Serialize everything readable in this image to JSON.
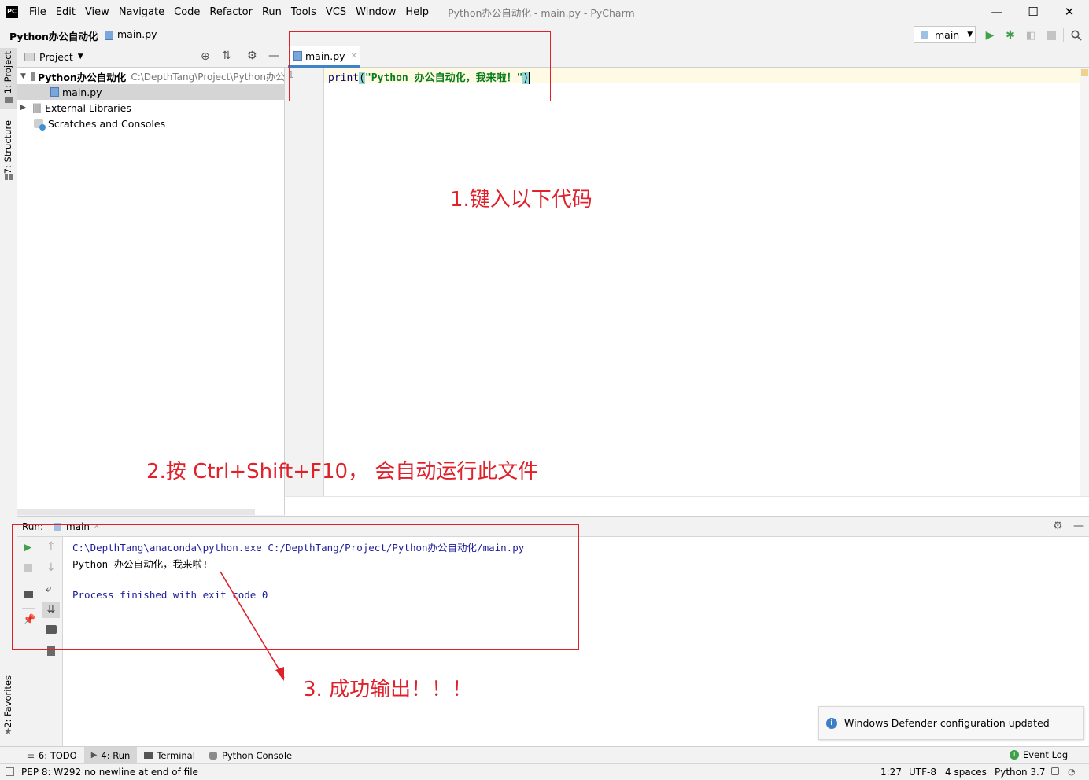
{
  "window": {
    "title": "Python办公自动化 - main.py - PyCharm"
  },
  "menu": [
    {
      "label": "File"
    },
    {
      "label": "Edit"
    },
    {
      "label": "View"
    },
    {
      "label": "Navigate"
    },
    {
      "label": "Code"
    },
    {
      "label": "Refactor"
    },
    {
      "label": "Run"
    },
    {
      "label": "Tools"
    },
    {
      "label": "VCS"
    },
    {
      "label": "Window"
    },
    {
      "label": "Help"
    }
  ],
  "breadcrumb": {
    "project": "Python办公自动化",
    "file": "main.py"
  },
  "run_config": {
    "label": "main"
  },
  "side_tabs": {
    "project": "1: Project",
    "structure": "7: Structure",
    "favorites": "2: Favorites"
  },
  "project_panel": {
    "title": "Project",
    "tree": [
      {
        "label": "Python办公自动化",
        "path": "C:\\DepthTang\\Project\\Python办公"
      },
      {
        "label": "main.py"
      },
      {
        "label": "External Libraries"
      },
      {
        "label": "Scratches and Consoles"
      }
    ]
  },
  "editor": {
    "tab_label": "main.py",
    "line_number": "1",
    "code": {
      "func": "print",
      "open": "(",
      "string": "\"Python 办公自动化，我来啦！\"",
      "close": ")"
    }
  },
  "run_panel": {
    "title": "Run:",
    "tab_label": "main",
    "console": [
      "C:\\DepthTang\\anaconda\\python.exe C:/DepthTang/Project/Python办公自动化/main.py",
      "Python 办公自动化，我来啦!",
      "Process finished with exit code 0"
    ]
  },
  "annotations": {
    "step1": "1.键入以下代码",
    "step2": "2.按 Ctrl+Shift+F10， 会自动运行此文件",
    "step3": "3. 成功输出！！！"
  },
  "notification": {
    "text": "Windows Defender configuration updated"
  },
  "bottom_tabs": [
    {
      "label": "6: TODO"
    },
    {
      "label": "4: Run"
    },
    {
      "label": "Terminal"
    },
    {
      "label": "Python Console"
    }
  ],
  "event_log": {
    "label": "Event Log",
    "count": "1"
  },
  "status_bar": {
    "message": "PEP 8: W292 no newline at end of file",
    "position": "1:27",
    "encoding": "UTF-8",
    "indent": "4 spaces",
    "interpreter": "Python 3.7"
  },
  "colors": {
    "accent_red": "#e0202a",
    "keyword_blue": "#000080",
    "string_green": "#067d17",
    "run_green": "#3fa14a",
    "console_blue": "#1c1c99"
  }
}
